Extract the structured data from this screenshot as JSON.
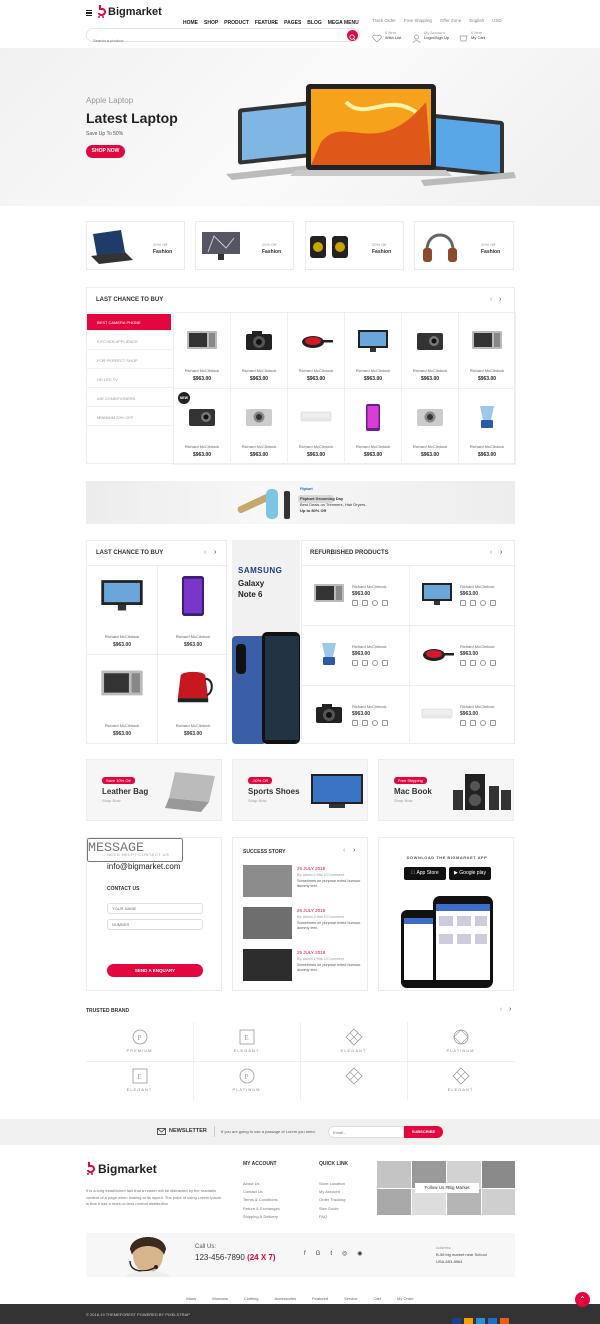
{
  "header": {
    "logo": "Bigmarket",
    "nav": [
      "HOME",
      "SHOP",
      "PRODUCT",
      "FEATURE",
      "PAGES",
      "BLOG",
      "MEGA MENU"
    ],
    "top_links": [
      "Track Order",
      "Free Shipping",
      "Offer Zone"
    ],
    "language": "English",
    "currency": "USD",
    "search_placeholder": "Search a product",
    "wishlist_top": "0 Item",
    "wishlist_label": "Wish List",
    "account_top": "My Account",
    "account_label": "Login/Sign Up",
    "cart_top": "0 Item",
    "cart_label": "My Cart"
  },
  "hero": {
    "eyebrow": "Apple Laptop",
    "title": "Latest Laptop",
    "subtitle": "Save Up To 50%",
    "button": "SHOP NOW"
  },
  "category_cards": [
    {
      "off": "20% Off",
      "label": "Fashion"
    },
    {
      "off": "20% Off",
      "label": "Fashion"
    },
    {
      "off": "20% Off",
      "label": "Fashion"
    },
    {
      "off": "20% Off",
      "label": "Fashion"
    }
  ],
  "last_chance": {
    "title": "LAST CHANCE TO BUY",
    "categories": [
      "BEST CAMERA PHONE",
      "KITCHEN APPLIENCE",
      "FOR PERFECT SHOP",
      "HD LED TV",
      "AIR CONDITIONERS",
      "MINIMUM 20% OFF"
    ],
    "new_badge": "NEW"
  },
  "product": {
    "name": "Richard McClintock",
    "price": "$963.00"
  },
  "promo_banner": {
    "brand": "Flipkart",
    "line1": "Flipkart Grooming Day",
    "line2": "Best Deals on Trimmers, Hair Dryers..",
    "line3": "Up to 80% Off"
  },
  "last_chance2": {
    "title": "LAST CHANCE TO BUY"
  },
  "samsung": {
    "brand": "SAMSUNG",
    "line1": "Galaxy",
    "line2": "Note 6"
  },
  "refurbished": {
    "title": "REFURBISHED PRODUCTS"
  },
  "offers": [
    {
      "badge": "Save 10% Off",
      "title": "Leather Bag",
      "link": "Shop Now"
    },
    {
      "badge": "-50% Off",
      "title": "Sports Shoes",
      "link": "Shop Now"
    },
    {
      "badge": "Free Shipping",
      "title": "Mac Book",
      "link": "Shop Now"
    }
  ],
  "contact": {
    "help": "NEED HELP? CONTACT US",
    "email": "info@bigmarket.com",
    "title": "CONTACT US",
    "name_ph": "YOUR NAME",
    "number_ph": "NUMBER",
    "message_ph": "MESSAGE",
    "button": "SEND A ENQUARY"
  },
  "stories": {
    "title": "SUCCESS STORY",
    "items": [
      {
        "date": "25 JULY 2018",
        "meta": "By: Admin 2 Hits 10 Comment",
        "text": "Sometimes on purpose ected humour. dummy text."
      },
      {
        "date": "25 JULY 2018",
        "meta": "By: Admin 2 Hits 10 Comment",
        "text": "Sometimes on purpose ected humour. dummy text."
      },
      {
        "date": "25 JULY 2018",
        "meta": "By: Admin 2 Hits 10 Comment",
        "text": "Sometimes on purpose ected humour. dummy text."
      }
    ]
  },
  "app": {
    "title": "DOWNLOAD THE BIGMARKET APP",
    "appstore": "App Store",
    "googleplay": "Google play"
  },
  "brands": {
    "title": "TRUSTED BRAND",
    "names": [
      "PREMIUM",
      "ELEGANT",
      "ELEGANT",
      "PLATINUM",
      "ELEGANT",
      "PLATINUM",
      "",
      "ELEGANT"
    ]
  },
  "newsletter": {
    "title": "NEWSLETTER",
    "text": "If you are going to use a passage of Lorem you need.",
    "placeholder": "Email...",
    "button": "SUBSCRIBE"
  },
  "footer": {
    "about": "It is a long established fact that a reader will be distracted by the readable content of a page when looking at its layout. The point of using Lorem Ipsum is that it has a more-or-less normal distribution",
    "account_title": "MY ACCOUNT",
    "account_links": [
      "About Us",
      "Contact Us",
      "Terms & Conditions",
      "Return & Exchanges",
      "Shipping & Delivery"
    ],
    "quick_title": "QUICK LINK",
    "quick_links": [
      "Store Location",
      "My Account",
      "Order Tracking",
      "Size Guide",
      "FAQ"
    ],
    "instagram": "Follow Us #Big Market",
    "call_label": "Call Us:",
    "phone": "123-456-7890",
    "phone_suffix": "(24 X 7)",
    "address_label": "Address",
    "address1": "B-56 big market near School",
    "address2": "USA-653-8964",
    "bottom_nav": [
      "Mans",
      "Womans",
      "Clothing",
      "Accessories",
      "Featured",
      "Service",
      "Cart",
      "My Order"
    ],
    "copyright": "© 2018-19 THEMEFOREST POWERED BY PIXELSTRAP"
  },
  "colors": {
    "accent": "#e4063f",
    "dark_footer": "#333333"
  }
}
